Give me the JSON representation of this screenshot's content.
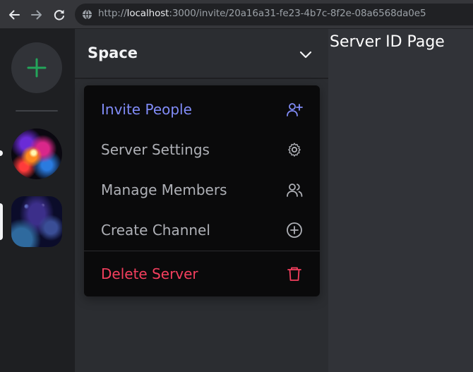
{
  "browser": {
    "url_prefix": "http://",
    "url_host": "localhost",
    "url_rest": ":3000/invite/20a16a31-fe23-4b7c-8f2e-08a6568da0e5"
  },
  "rail": {
    "add_icon": "plus-icon",
    "accent": "#23a55a",
    "servers": [
      {
        "name": "server-1",
        "selected": false,
        "indicator": "dot"
      },
      {
        "name": "server-2",
        "selected": true,
        "indicator": "pill"
      }
    ]
  },
  "sidebar": {
    "server_name": "Space",
    "chevron_icon": "chevron-down-icon"
  },
  "menu": {
    "items": [
      {
        "label": "Invite People",
        "icon": "user-plus-icon",
        "color": "#818cf8"
      },
      {
        "label": "Server Settings",
        "icon": "gear-icon",
        "color": "#aeb0b6"
      },
      {
        "label": "Manage Members",
        "icon": "users-icon",
        "color": "#aeb0b6"
      },
      {
        "label": "Create Channel",
        "icon": "plus-circle-icon",
        "color": "#aeb0b6"
      },
      {
        "label": "Delete Server",
        "icon": "trash-icon",
        "color": "#f43f5e"
      }
    ]
  },
  "main": {
    "title": "Server ID Page"
  }
}
